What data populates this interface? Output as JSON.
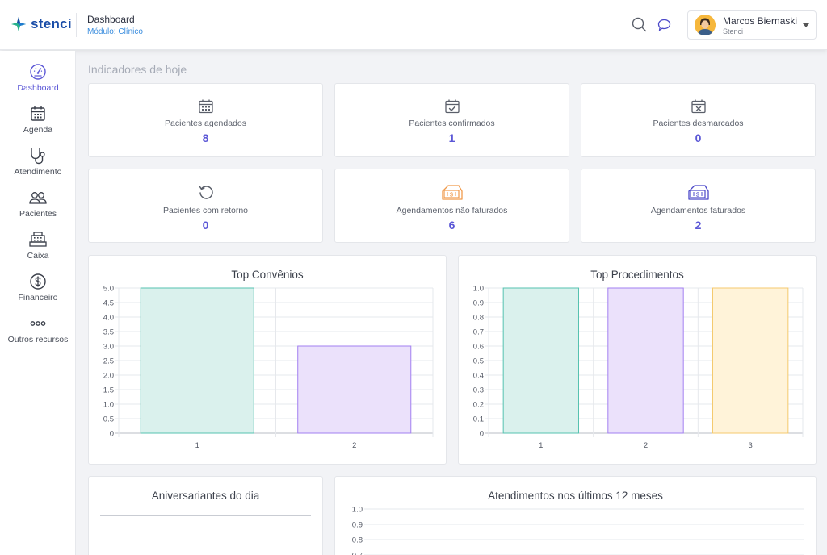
{
  "header": {
    "logo_text": "stenci",
    "page_title": "Dashboard",
    "module": "Módulo: Clínico",
    "user_name": "Marcos Biernaski",
    "user_org": "Stenci"
  },
  "sidebar": {
    "items": [
      {
        "label": "Dashboard",
        "icon": "speedometer-icon",
        "active": true
      },
      {
        "label": "Agenda",
        "icon": "calendar-icon"
      },
      {
        "label": "Atendimento",
        "icon": "stethoscope-icon"
      },
      {
        "label": "Pacientes",
        "icon": "users-icon"
      },
      {
        "label": "Caixa",
        "icon": "cash-register-icon"
      },
      {
        "label": "Financeiro",
        "icon": "dollar-circle-icon"
      },
      {
        "label": "Outros recursos",
        "icon": "more-dots-icon"
      }
    ]
  },
  "main": {
    "section_title": "Indicadores de hoje",
    "kpis": [
      {
        "label": "Pacientes agendados",
        "value": "8",
        "icon": "calendar-grid-icon"
      },
      {
        "label": "Pacientes confirmados",
        "value": "1",
        "icon": "calendar-check-icon"
      },
      {
        "label": "Pacientes desmarcados",
        "value": "0",
        "icon": "calendar-x-icon"
      },
      {
        "label": "Pacientes com retorno",
        "value": "0",
        "icon": "return-arrow-icon"
      },
      {
        "label": "Agendamentos não faturados",
        "value": "6",
        "icon": "ticket-dollar-icon"
      },
      {
        "label": "Agendamentos faturados",
        "value": "2",
        "icon": "ticket-dollar-icon"
      }
    ],
    "birthdays_title": "Aniversariantes do dia"
  },
  "colors": {
    "accent": "#5b57d6",
    "teal_fill": "#daf1ed",
    "teal_stroke": "#55c2b0",
    "purple_fill": "#ebe1fb",
    "purple_stroke": "#a27ff0",
    "yellow_fill": "#fff3d9",
    "yellow_stroke": "#f4ca6e",
    "orange_icon": "#f09a4b"
  },
  "chart_data": [
    {
      "type": "bar",
      "title": "Top Convênios",
      "categories": [
        "1",
        "2"
      ],
      "values": [
        5.0,
        3.0
      ],
      "ylim": [
        0,
        5
      ],
      "yticks": [
        "0",
        "0.5",
        "1.0",
        "1.5",
        "2.0",
        "2.5",
        "3.0",
        "3.5",
        "4.0",
        "4.5",
        "5.0"
      ],
      "grid": true
    },
    {
      "type": "bar",
      "title": "Top Procedimentos",
      "categories": [
        "1",
        "2",
        "3"
      ],
      "values": [
        1.0,
        1.0,
        1.0
      ],
      "ylim": [
        0,
        1
      ],
      "yticks": [
        "0",
        "0.1",
        "0.2",
        "0.3",
        "0.4",
        "0.5",
        "0.6",
        "0.7",
        "0.8",
        "0.9",
        "1.0"
      ],
      "grid": true
    },
    {
      "type": "line",
      "title": "Atendimentos nos últimos 12 meses",
      "ylim": [
        0,
        1
      ],
      "yticks_visible": [
        "1.0",
        "0.9",
        "0.8",
        "0.7"
      ],
      "grid": true
    }
  ]
}
